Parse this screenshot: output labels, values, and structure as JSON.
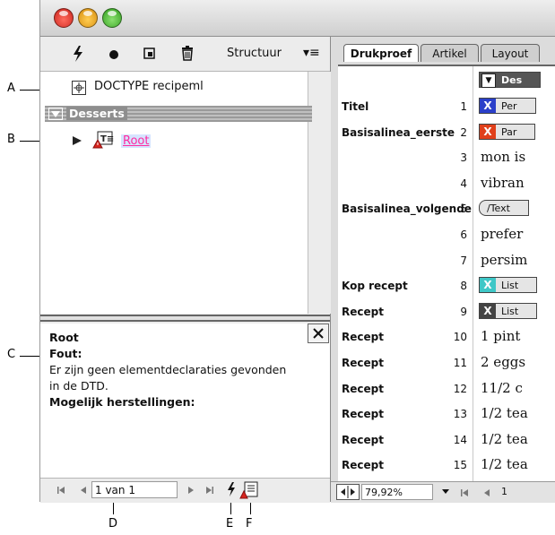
{
  "callouts": {
    "a": "A",
    "b": "B",
    "c": "C",
    "d": "D",
    "e": "E",
    "f": "F"
  },
  "structure": {
    "toolbar": {
      "menu_label": "Structuur",
      "menu_icon": "▾≡"
    },
    "doctype": "DOCTYPE recipeml",
    "element": "Desserts",
    "root": "Root",
    "info": {
      "title": "Root",
      "error_label": "Fout:",
      "error_text_1": "Er zijn geen elementdeclaraties gevonden",
      "error_text_2": "in de DTD.",
      "fixes_label": "Mogelijk herstellingen:"
    },
    "pager_value": "1 van 1"
  },
  "story": {
    "tabs": [
      "Drukproef",
      "Artikel",
      "Layout"
    ],
    "top_tag": "Des",
    "rows": [
      {
        "tag": "Titel",
        "num": "1",
        "chip": "Per",
        "chip_color": "#2a3fc9",
        "chip_x": "X"
      },
      {
        "tag": "Basisalinea_eerste",
        "num": "2",
        "chip": "Par",
        "chip_color": "#e0401b",
        "chip_x": "X"
      },
      {
        "tag": "",
        "num": "3",
        "content": "mon is"
      },
      {
        "tag": "",
        "num": "4",
        "content": "vibran"
      },
      {
        "tag": "Basisalinea_volgende",
        "num": "5",
        "chip": "/Text"
      },
      {
        "tag": "",
        "num": "6",
        "content": "prefer"
      },
      {
        "tag": "",
        "num": "7",
        "content": "persim"
      },
      {
        "tag": "Kop recept",
        "num": "8",
        "chip": "List",
        "chip_color": "#3ec7c7",
        "chip_x": "X"
      },
      {
        "tag": "Recept",
        "num": "9",
        "chip": "List",
        "chip_color": "#444444",
        "chip_x": "X"
      },
      {
        "tag": "Recept",
        "num": "10",
        "content": "1 pint"
      },
      {
        "tag": "Recept",
        "num": "11",
        "content": "2 eggs"
      },
      {
        "tag": "Recept",
        "num": "12",
        "content": "11/2 c"
      },
      {
        "tag": "Recept",
        "num": "13",
        "content": "1/2 tea"
      },
      {
        "tag": "Recept",
        "num": "14",
        "content": "1/2 tea"
      },
      {
        "tag": "Recept",
        "num": "15",
        "content": "1/2 tea"
      }
    ],
    "zoom": "79,92%",
    "page_value": "1"
  },
  "colors": {
    "root_link": "#ff2aa0",
    "accent_red": "#d8241e",
    "accent_blue": "#2a3fc9"
  }
}
